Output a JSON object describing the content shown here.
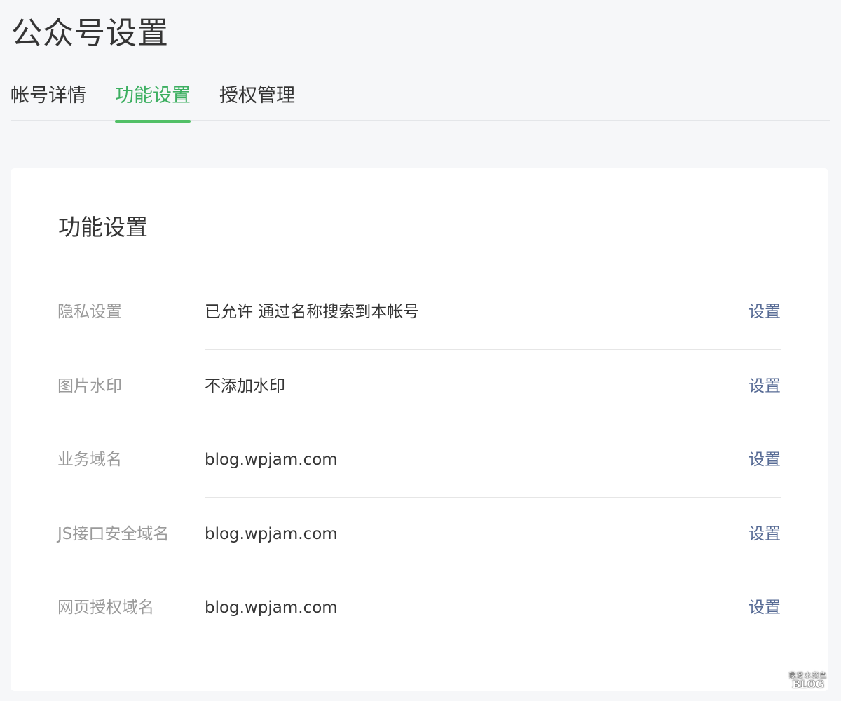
{
  "header": {
    "title": "公众号设置"
  },
  "tabs": [
    {
      "label": "帐号详情",
      "active": false
    },
    {
      "label": "功能设置",
      "active": true
    },
    {
      "label": "授权管理",
      "active": false
    }
  ],
  "card": {
    "title": "功能设置",
    "rows": [
      {
        "label": "隐私设置",
        "value": "已允许 通过名称搜索到本帐号",
        "action": "设置"
      },
      {
        "label": "图片水印",
        "value": "不添加水印",
        "action": "设置"
      },
      {
        "label": "业务域名",
        "value": "blog.wpjam.com",
        "action": "设置"
      },
      {
        "label": "JS接口安全域名",
        "value": "blog.wpjam.com",
        "action": "设置"
      },
      {
        "label": "网页授权域名",
        "value": "blog.wpjam.com",
        "action": "设置"
      }
    ]
  },
  "watermark": {
    "top": "我爱水煮鱼",
    "bottom": "BLOG"
  },
  "colors": {
    "accent": "#3daf61",
    "link": "#576b95",
    "background": "#f6f7f9",
    "card": "#ffffff"
  }
}
